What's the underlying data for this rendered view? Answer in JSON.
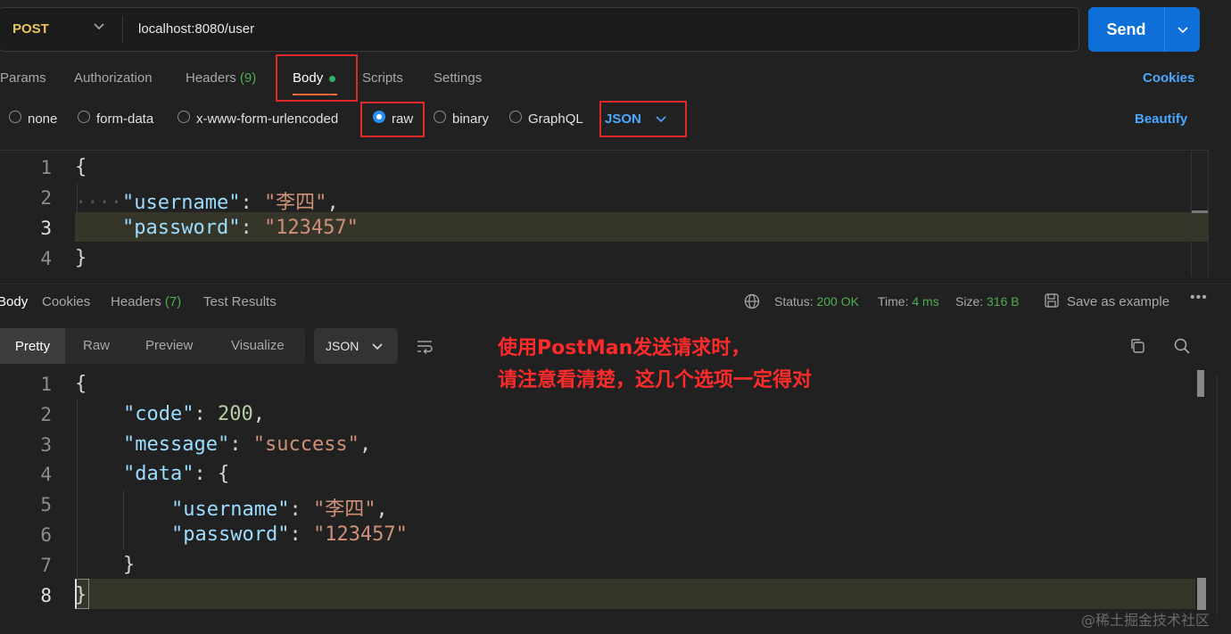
{
  "request": {
    "method": "POST",
    "url": "localhost:8080/user",
    "send_label": "Send"
  },
  "request_tabs": {
    "params": "Params",
    "authorization": "Authorization",
    "headers": "Headers",
    "headers_count": "(9)",
    "body": "Body",
    "scripts": "Scripts",
    "settings": "Settings",
    "cookies": "Cookies"
  },
  "body_types": {
    "none": "none",
    "form_data": "form-data",
    "urlencoded": "x-www-form-urlencoded",
    "raw": "raw",
    "binary": "binary",
    "graphql": "GraphQL",
    "selected": "raw",
    "raw_language": "JSON",
    "beautify": "Beautify"
  },
  "request_body": {
    "line_numbers": [
      "1",
      "2",
      "3",
      "4"
    ],
    "open": "{",
    "close": "}",
    "username_key": "\"username\"",
    "username_value": "\"李四\"",
    "password_key": "\"password\"",
    "password_value": "\"123457\""
  },
  "response_tabs": {
    "body": "Body",
    "cookies": "Cookies",
    "headers": "Headers",
    "headers_count": "(7)",
    "test_results": "Test Results"
  },
  "response_meta": {
    "status_label": "Status:",
    "status_value": "200 OK",
    "time_label": "Time:",
    "time_value": "4 ms",
    "size_label": "Size:",
    "size_value": "316 B",
    "save_as_example": "Save as example",
    "more": "•••"
  },
  "response_view": {
    "pretty": "Pretty",
    "raw": "Raw",
    "preview": "Preview",
    "visualize": "Visualize",
    "format": "JSON"
  },
  "response_body": {
    "line_numbers": [
      "1",
      "2",
      "3",
      "4",
      "5",
      "6",
      "7",
      "8"
    ],
    "open": "{",
    "close": "}",
    "code_key": "\"code\"",
    "code_value": "200",
    "message_key": "\"message\"",
    "message_value": "\"success\"",
    "data_key": "\"data\"",
    "data_open": "{",
    "data_close": "}",
    "username_key": "\"username\"",
    "username_value": "\"李四\"",
    "password_key": "\"password\"",
    "password_value": "\"123457\""
  },
  "annotation": {
    "line1": "使用PostMan发送请求时，",
    "line2": "请注意看清楚，这几个选项一定得对"
  },
  "watermark": "@稀土掘金技术社区",
  "colors": {
    "send_button": "#0e6fd9",
    "method": "#e8c65a",
    "highlight_box": "#e02a2a",
    "link_blue": "#4aa8ff",
    "status_green": "#4caf50",
    "annotation_red": "#ff2a2a"
  }
}
